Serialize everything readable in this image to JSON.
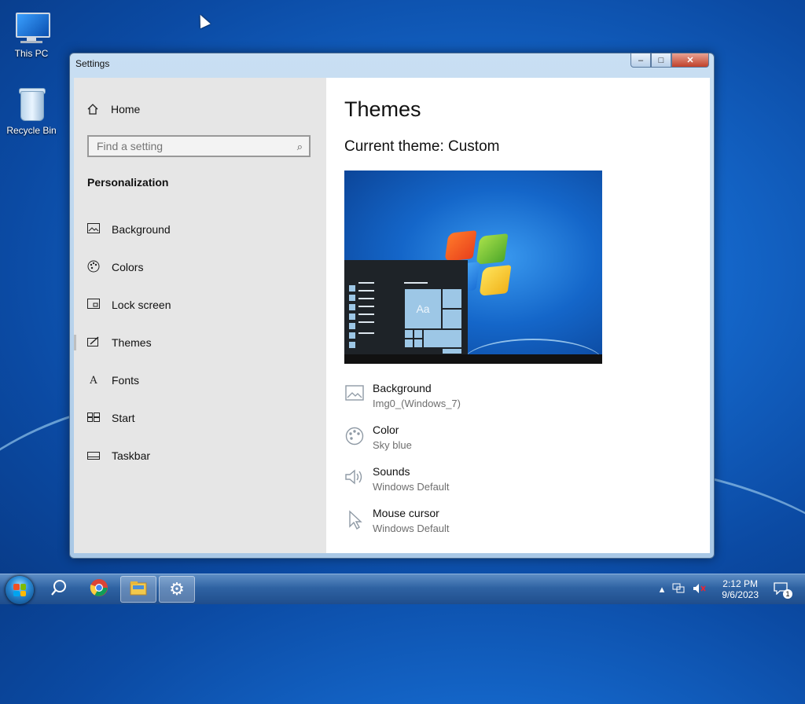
{
  "desktop": {
    "icons": [
      {
        "label": "This PC"
      },
      {
        "label": "Recycle Bin"
      }
    ]
  },
  "window": {
    "title": "Settings",
    "controls": {
      "minimize": "–",
      "maximize": "□",
      "close": "✕"
    }
  },
  "sidebar": {
    "home_label": "Home",
    "search_placeholder": "Find a setting",
    "section_title": "Personalization",
    "items": [
      {
        "label": "Background",
        "icon": "image-icon"
      },
      {
        "label": "Colors",
        "icon": "palette-icon"
      },
      {
        "label": "Lock screen",
        "icon": "lock-screen-icon"
      },
      {
        "label": "Themes",
        "icon": "brush-icon",
        "selected": true
      },
      {
        "label": "Fonts",
        "icon": "font-icon"
      },
      {
        "label": "Start",
        "icon": "start-tiles-icon"
      },
      {
        "label": "Taskbar",
        "icon": "taskbar-icon"
      }
    ]
  },
  "content": {
    "title": "Themes",
    "current_theme": "Current theme: Custom",
    "preview": {
      "tile_text": "Aa"
    },
    "properties": [
      {
        "title": "Background",
        "value": "Img0_(Windows_7)",
        "icon": "image-icon"
      },
      {
        "title": "Color",
        "value": "Sky blue",
        "icon": "palette-icon"
      },
      {
        "title": "Sounds",
        "value": "Windows Default",
        "icon": "speaker-icon"
      },
      {
        "title": "Mouse cursor",
        "value": "Windows Default",
        "icon": "cursor-icon"
      }
    ]
  },
  "taskbar": {
    "clock_time": "2:12 PM",
    "clock_date": "9/6/2023",
    "notification_count": "1",
    "apps": [
      "search-icon",
      "chrome-icon",
      "file-explorer-icon",
      "settings-gear-icon"
    ]
  },
  "colors": {
    "sidebar_bg": "#e6e6e6",
    "accent": "#1466c9"
  }
}
